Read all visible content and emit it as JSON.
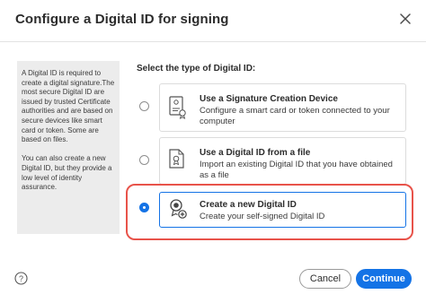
{
  "dialog": {
    "title": "Configure a Digital ID for signing"
  },
  "info_panel": {
    "paragraph_1": "A Digital ID is required to create a digital signature.The most secure Digital ID are issued by trusted Certificate authorities and are based on secure devices like smart card or token. Some are based on files.",
    "paragraph_2": "You can also create a new Digital ID, but they provide a low level of identity assurance."
  },
  "select_label": "Select the type of Digital ID:",
  "options": [
    {
      "title": "Use a Signature Creation Device",
      "description": "Configure a smart card or token connected to your computer",
      "icon": "signature-device-icon",
      "selected": false
    },
    {
      "title": "Use a Digital ID from a file",
      "description": "Import an existing Digital ID that you have obtained as a file",
      "icon": "digital-id-file-icon",
      "selected": false
    },
    {
      "title": "Create a new Digital ID",
      "description": "Create your self-signed Digital ID",
      "icon": "new-digital-id-icon",
      "selected": true
    }
  ],
  "buttons": {
    "cancel": "Cancel",
    "continue": "Continue"
  },
  "colors": {
    "accent": "#1473e6",
    "highlight": "#e8534a",
    "panel_bg": "#ececec"
  }
}
